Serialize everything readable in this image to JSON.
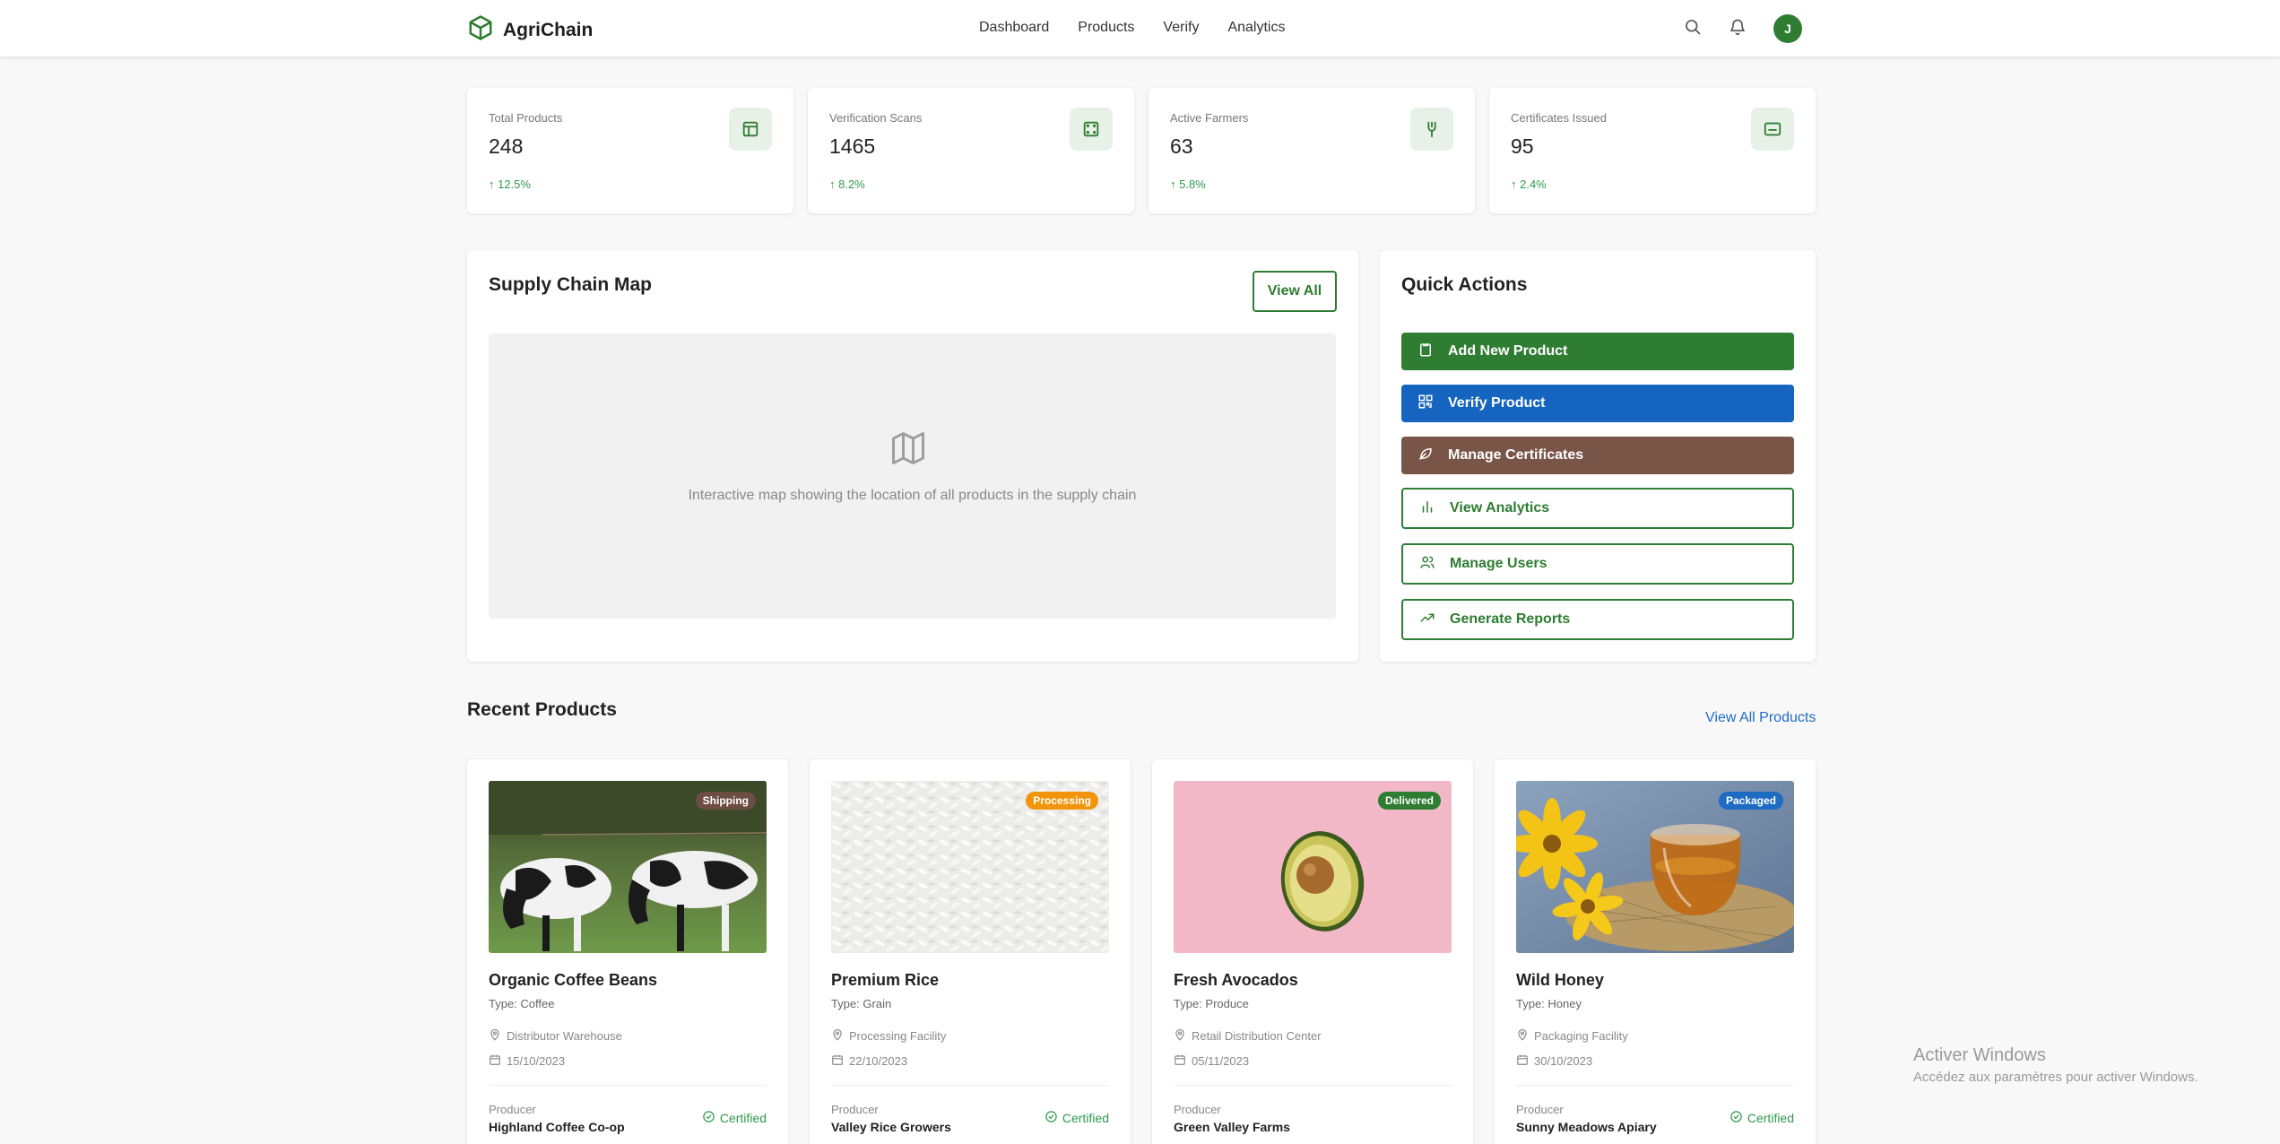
{
  "app": {
    "name": "AgriChain"
  },
  "nav": [
    "Dashboard",
    "Products",
    "Verify",
    "Analytics"
  ],
  "user": {
    "initial": "J"
  },
  "stats": [
    {
      "label": "Total Products",
      "value": "248",
      "change": "↑ 12.5%",
      "icon": "grid-icon"
    },
    {
      "label": "Verification Scans",
      "value": "1465",
      "change": "↑ 8.2%",
      "icon": "scan-icon"
    },
    {
      "label": "Active Farmers",
      "value": "63",
      "change": "↑ 5.8%",
      "icon": "sprout-icon"
    },
    {
      "label": "Certificates Issued",
      "value": "95",
      "change": "↑ 2.4%",
      "icon": "certificate-icon"
    }
  ],
  "supply_map": {
    "title": "Supply Chain Map",
    "view_all": "View All",
    "placeholder": "Interactive map showing the location of all products in the supply chain"
  },
  "quick_actions": {
    "title": "Quick Actions",
    "actions": [
      {
        "label": "Add New Product",
        "style": "solid",
        "color": "#2e7d32",
        "icon": "clipboard-icon"
      },
      {
        "label": "Verify Product",
        "style": "solid",
        "color": "#1565c0",
        "icon": "qr-icon"
      },
      {
        "label": "Manage Certificates",
        "style": "solid",
        "color": "#795548",
        "icon": "leaf-icon"
      },
      {
        "label": "View Analytics",
        "style": "outline",
        "color": "#2e7d32",
        "icon": "bar-chart-icon"
      },
      {
        "label": "Manage Users",
        "style": "outline",
        "color": "#2e7d32",
        "icon": "users-icon"
      },
      {
        "label": "Generate Reports",
        "style": "outline",
        "color": "#2e7d32",
        "icon": "trending-up-icon"
      }
    ]
  },
  "recent": {
    "title": "Recent Products",
    "view_all": "View All Products",
    "producer_label": "Producer",
    "products": [
      {
        "name": "Organic Coffee Beans",
        "type": "Type: Coffee",
        "location": "Distributor Warehouse",
        "date": "15/10/2023",
        "producer": "Highland Coffee Co-op",
        "status": "Shipping",
        "status_color": "#6d4c41",
        "certified": "Certified"
      },
      {
        "name": "Premium Rice",
        "type": "Type: Grain",
        "location": "Processing Facility",
        "date": "22/10/2023",
        "producer": "Valley Rice Growers",
        "status": "Processing",
        "status_color": "#f0950c",
        "certified": "Certified"
      },
      {
        "name": "Fresh Avocados",
        "type": "Type: Produce",
        "location": "Retail Distribution Center",
        "date": "05/11/2023",
        "producer": "Green Valley Farms",
        "status": "Delivered",
        "status_color": "#2e7d32",
        "certified": ""
      },
      {
        "name": "Wild Honey",
        "type": "Type: Honey",
        "location": "Packaging Facility",
        "date": "30/10/2023",
        "producer": "Sunny Meadows Apiary",
        "status": "Packaged",
        "status_color": "#1e6bc4",
        "certified": "Certified"
      }
    ]
  },
  "watermark": {
    "line1": "Activer Windows",
    "line2": "Accédez aux paramètres pour activer Windows."
  }
}
